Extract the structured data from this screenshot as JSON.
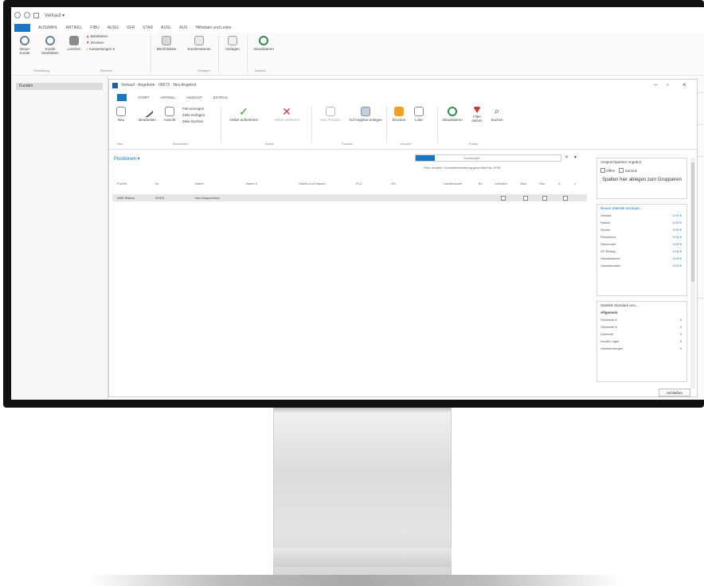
{
  "outer": {
    "title": "Verkauf ▾",
    "tabs": [
      "AUSWAHL",
      "ARTIKEL",
      "FIBU",
      "AUSG",
      "VER",
      "STAR",
      "AUSL",
      "AUS",
      "Hilfsdatei und Leiste"
    ],
    "ribbon": {
      "buttons": [
        "Neuer Kunde",
        "Kunde bearbeiten",
        "Löschen",
        "Bearbeiten",
        "Drucken",
        "Ansicht",
        "Berichtsliste",
        "Kundenstamm",
        "Vorlagen",
        "Aktualisieren"
      ],
      "small_items": [
        "Bearbeiten",
        "Drucken",
        "Auswertungen ▾"
      ],
      "groups": [
        "Verwaltung",
        "Berichte",
        "Vorlagen",
        "Ansicht"
      ]
    },
    "sidebar": {
      "selected": "Kunden"
    }
  },
  "inner": {
    "title": "Verkauf · Angebote · 00073 · Neu Angebot",
    "tabs": [
      "START",
      "ARTIKEL",
      "ANSICHT",
      "EXTRAS"
    ],
    "ribbon": {
      "buttons": [
        "Neu",
        "Bearbeiten",
        "Ansicht",
        "Artikel aufnehmen",
        "Artikel entfernen",
        "Neu Position",
        "Auf Angebot anlegen",
        "Drucken",
        "Liste",
        "Aktualisieren",
        "Filter setzen",
        "Suchen"
      ],
      "small_items": [
        "Fett anzeigen",
        "Zeile einfügen",
        "Zeile löschen"
      ],
      "groups": [
        "Neu",
        "Bearbeiten",
        "Artikel",
        "Position",
        "Ansicht",
        "Extras"
      ]
    },
    "grid": {
      "title": "Positionen ▾",
      "search_placeholder": "Suchbegriff",
      "filter_text": "Filter ist aktiv:   Kontrollbestimmung geschützt bis: 5738",
      "columns": [
        "Pos/Nr.",
        "Nr.",
        "Name",
        "Name 2",
        "Straße und Hausnr.",
        "PLZ",
        "Ort",
        "Länderkürzel",
        "Br.",
        "Lieferant",
        "Abw.",
        "Rec.",
        "A",
        "x"
      ],
      "row": {
        "pos": "ANR Stämm",
        "nr": "00075",
        "name": "Neu Ansprechner"
      }
    },
    "pane": {
      "filter_title": "Ansprechpartner Angebot",
      "opts": [
        "Offen",
        "Summe"
      ],
      "drop_hint": "Spalten hier ablegen zum Gruppieren",
      "summary_title": "Neuen Statistik anzeigen",
      "summary": [
        {
          "k": "Umsatz",
          "v": "0,00 €"
        },
        {
          "k": "Rabatt",
          "v": "0,00 €"
        },
        {
          "k": "Skonto",
          "v": "0,00 €"
        },
        {
          "k": "Rückstand",
          "v": "0,00 €"
        },
        {
          "k": "Steuerzahl",
          "v": "0,00 €"
        },
        {
          "k": "OP Betrag",
          "v": "0,00 €"
        },
        {
          "k": "Umsatzsteuer",
          "v": "0,00 €"
        },
        {
          "k": "Umsatzkosten",
          "v": "0,00 €"
        }
      ],
      "lower_title": "Statistik Standard neu...",
      "lower_section": "Allgemein",
      "lower_items": [
        {
          "k": "Stückliste A",
          "v": "0"
        },
        {
          "k": "Stückliste B",
          "v": "0"
        },
        {
          "k": "Lieferzeit",
          "v": "0"
        },
        {
          "k": "Anzahl Lager",
          "v": "0"
        },
        {
          "k": "Umsatzmengen",
          "v": "0"
        }
      ]
    },
    "close_button": "Schließen"
  },
  "colors": {
    "accent": "#1976c2",
    "bezel": "#111111"
  },
  "icons": {
    "green_check": "#3a9b3a",
    "red_x": "#d23c3c",
    "refresh": "#2f8c4a",
    "filter": "#c63c3c",
    "orange": "#f0a020"
  }
}
